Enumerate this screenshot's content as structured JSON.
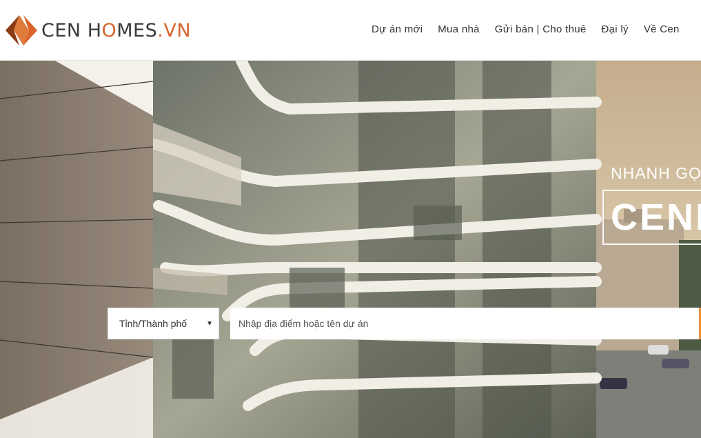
{
  "logo": {
    "part1": "CEN H",
    "part2": "MES",
    "part3": ".VN",
    "mark_color": "#d9642c"
  },
  "nav": {
    "items": [
      "Dự án mới",
      "Mua nhà",
      "Gửi bán | Cho thuê",
      "Đại lý",
      "Về Cen"
    ]
  },
  "hero": {
    "slogan": "NHANH GỌ",
    "brand": "CENH"
  },
  "search": {
    "city_label": "Tỉnh/Thành phố",
    "placeholder": "Nhập địa điểm hoặc tên dự án",
    "button_color": "#e8943a"
  }
}
